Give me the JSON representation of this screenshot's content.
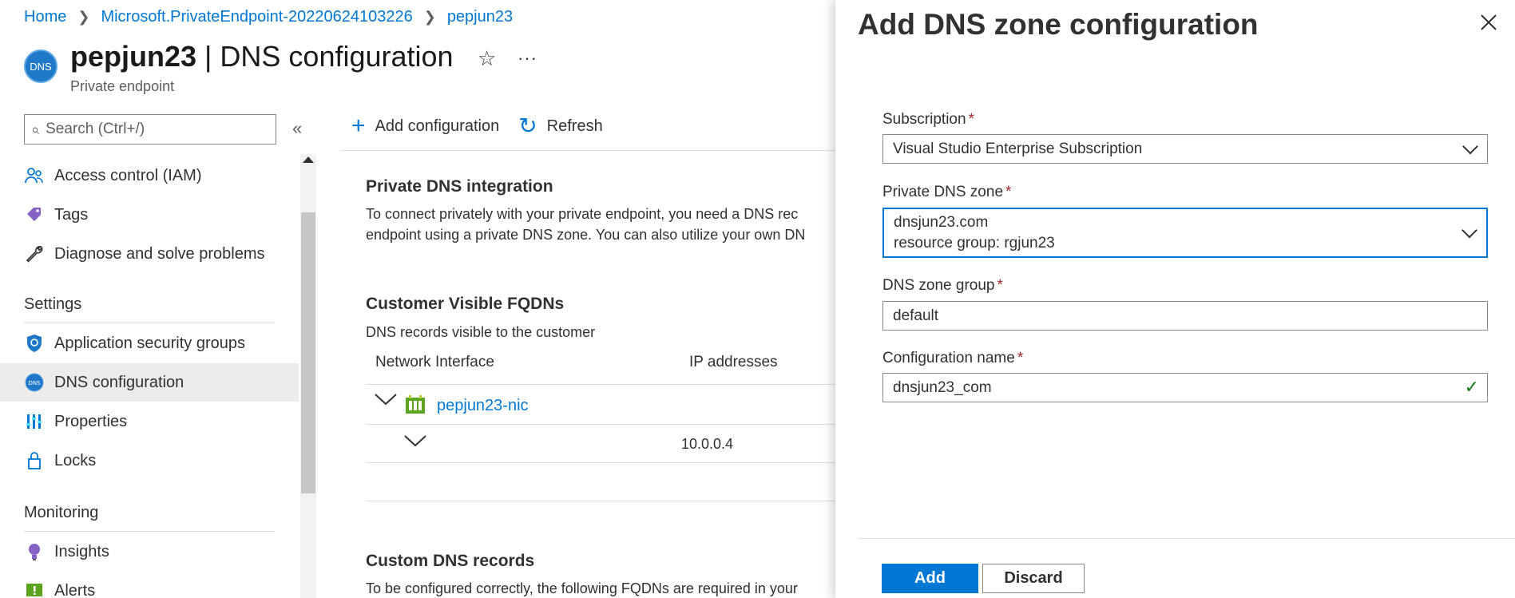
{
  "breadcrumb": {
    "items": [
      "Home",
      "Microsoft.PrivateEndpoint-20220624103226",
      "pepjun23"
    ]
  },
  "header": {
    "icon_text": "DNS",
    "resource_name": "pepjun23",
    "separator": "|",
    "page_name": "DNS configuration",
    "subtitle": "Private endpoint"
  },
  "sidebar": {
    "search_placeholder": "Search (Ctrl+/)",
    "items_top": [
      {
        "label": "Access control (IAM)",
        "icon": "people-icon"
      },
      {
        "label": "Tags",
        "icon": "tag-icon"
      },
      {
        "label": "Diagnose and solve problems",
        "icon": "wrench-icon"
      }
    ],
    "sections": [
      {
        "title": "Settings",
        "items": [
          {
            "label": "Application security groups",
            "icon": "shield-icon"
          },
          {
            "label": "DNS configuration",
            "icon": "dns-icon",
            "active": true
          },
          {
            "label": "Properties",
            "icon": "properties-icon"
          },
          {
            "label": "Locks",
            "icon": "lock-icon"
          }
        ]
      },
      {
        "title": "Monitoring",
        "items": [
          {
            "label": "Insights",
            "icon": "lightbulb-icon"
          },
          {
            "label": "Alerts",
            "icon": "alert-icon"
          }
        ]
      }
    ]
  },
  "toolbar": {
    "add_label": "Add configuration",
    "refresh_label": "Refresh"
  },
  "main": {
    "private_dns": {
      "title": "Private DNS integration",
      "line1": "To connect privately with your private endpoint, you need a DNS rec",
      "line2": "endpoint using a private DNS zone. You can also utilize your own DN"
    },
    "fqdns": {
      "title": "Customer Visible FQDNs",
      "subtitle": "DNS records visible to the customer",
      "col_network": "Network Interface",
      "col_ip": "IP addresses",
      "nic_name": "pepjun23-nic",
      "ip": "10.0.0.4"
    },
    "custom_dns": {
      "title": "Custom DNS records",
      "line1": "To be configured correctly, the following FQDNs are required in your"
    }
  },
  "panel": {
    "title": "Add DNS zone configuration",
    "subscription_label": "Subscription",
    "subscription_value": "Visual Studio Enterprise Subscription",
    "zone_label": "Private DNS zone",
    "zone_value": "dnsjun23.com",
    "zone_rg": "resource group: rgjun23",
    "group_label": "DNS zone group",
    "group_value": "default",
    "config_label": "Configuration name",
    "config_value": "dnsjun23_com",
    "required_mark": "*",
    "add_label": "Add",
    "discard_label": "Discard"
  },
  "colors": {
    "accent": "#0078d4",
    "required": "#a4262c",
    "valid": "#107c10"
  }
}
